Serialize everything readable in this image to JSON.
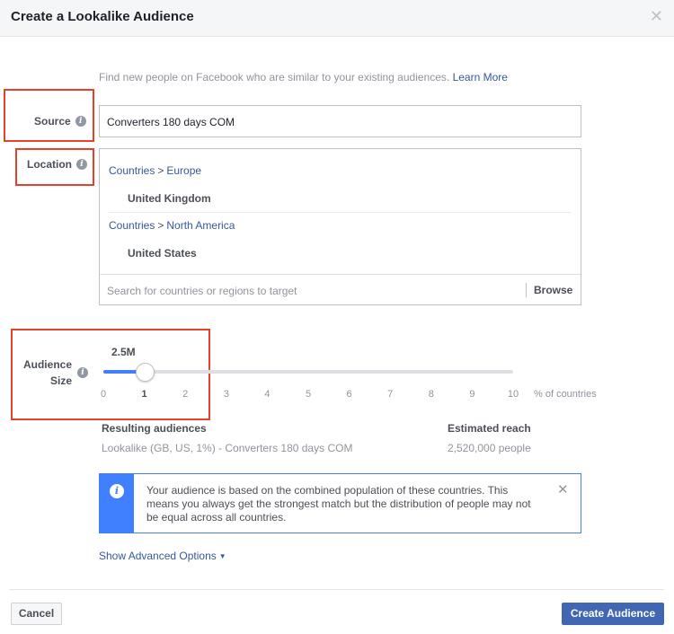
{
  "dialog": {
    "title": "Create a Lookalike Audience",
    "close_icon": "close-icon"
  },
  "intro": {
    "text": "Find new people on Facebook who are similar to your existing audiences.",
    "link": "Learn More"
  },
  "source": {
    "label": "Source",
    "value": "Converters 180 days COM"
  },
  "location": {
    "label": "Location",
    "groups": [
      {
        "root": "Countries",
        "separator": ">",
        "region": "Europe",
        "country": "United Kingdom"
      },
      {
        "root": "Countries",
        "separator": ">",
        "region": "North America",
        "country": "United States"
      }
    ],
    "search_placeholder": "Search for countries or regions to target",
    "browse": "Browse"
  },
  "audience_size": {
    "label_line1": "Audience",
    "label_line2": "Size",
    "value": "2.5M",
    "selected": 1,
    "min": 0,
    "max": 10,
    "ticks": [
      "0",
      "1",
      "2",
      "3",
      "4",
      "5",
      "6",
      "7",
      "8",
      "9",
      "10"
    ],
    "unit": "% of countries"
  },
  "results": {
    "resulting_heading": "Resulting audiences",
    "resulting_value": "Lookalike (GB, US, 1%) - Converters 180 days COM",
    "reach_heading": "Estimated reach",
    "reach_value": "2,520,000 people"
  },
  "notice": {
    "text": "Your audience is based on the combined population of these countries. This means you always get the strongest match but the distribution of people may not be equal across all countries."
  },
  "advanced": {
    "label": "Show Advanced Options"
  },
  "footer": {
    "cancel": "Cancel",
    "create": "Create Audience"
  },
  "colors": {
    "accent": "#4080ff",
    "primary_button": "#4267b2",
    "link": "#365899",
    "highlight_box": "#e8412a"
  }
}
